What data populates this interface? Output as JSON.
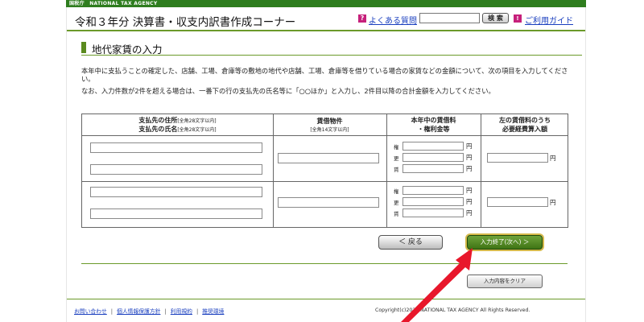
{
  "topbar": {
    "agency_text": "国税庁　NATIONAL TAX AGENCY"
  },
  "header": {
    "title": "令和３年分 決算書・収支内訳書作成コーナー",
    "faq_icon": "?",
    "faq_link": "よくある質問",
    "search_value": "",
    "search_button": "検 索",
    "guide_icon": "!",
    "guide_link": "ご利用ガイド"
  },
  "section": {
    "title": "地代家賃の入力"
  },
  "description": {
    "line1": "本年中に支払うことの確定した、店舗、工場、倉庫等の敷地の地代や店舗、工場、倉庫等を借りている場合の家賃などの金額について、次の項目を入力してください。",
    "line2": "なお、入力件数が2件を超える場合は、一番下の行の支払先の氏名等に「○○ほか」と入力し、2件目以降の合計金額を入力してください。"
  },
  "table": {
    "col1_address": "支払先の住所",
    "col1_address_note": "[全角28文字以内]",
    "col1_name": "支払先の氏名",
    "col1_name_note": "[全角28文字以内]",
    "col2": "賃借物件",
    "col2_note": "[全角14文字以内]",
    "col3_line1": "本年中の賃借料",
    "col3_line2": "・権利金等",
    "col4_line1": "左の賃借料のうち",
    "col4_line2": "必要経費算入額",
    "row_labels": [
      "権",
      "更",
      "賃"
    ],
    "unit": "円"
  },
  "buttons": {
    "back": "＜ 戻る",
    "next": "入力終了(次へ) ＞",
    "clear": "入力内容をクリア"
  },
  "footer": {
    "links": [
      "お問い合わせ",
      "個人情報保護方針",
      "利用規約",
      "推奨環境"
    ],
    "copyright": "Copyright(c)2022 NATIONAL TAX AGENCY All Rights Reserved."
  }
}
